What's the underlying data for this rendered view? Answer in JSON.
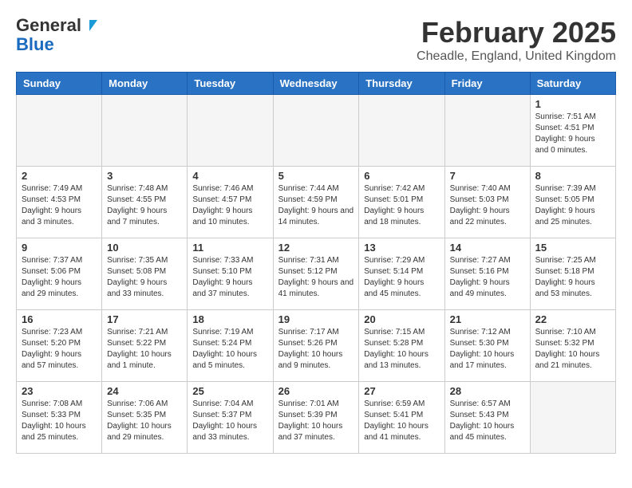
{
  "header": {
    "logo_general": "General",
    "logo_blue": "Blue",
    "title": "February 2025",
    "subtitle": "Cheadle, England, United Kingdom"
  },
  "weekdays": [
    "Sunday",
    "Monday",
    "Tuesday",
    "Wednesday",
    "Thursday",
    "Friday",
    "Saturday"
  ],
  "weeks": [
    [
      {
        "day": "",
        "info": ""
      },
      {
        "day": "",
        "info": ""
      },
      {
        "day": "",
        "info": ""
      },
      {
        "day": "",
        "info": ""
      },
      {
        "day": "",
        "info": ""
      },
      {
        "day": "",
        "info": ""
      },
      {
        "day": "1",
        "info": "Sunrise: 7:51 AM\nSunset: 4:51 PM\nDaylight: 9 hours and 0 minutes."
      }
    ],
    [
      {
        "day": "2",
        "info": "Sunrise: 7:49 AM\nSunset: 4:53 PM\nDaylight: 9 hours and 3 minutes."
      },
      {
        "day": "3",
        "info": "Sunrise: 7:48 AM\nSunset: 4:55 PM\nDaylight: 9 hours and 7 minutes."
      },
      {
        "day": "4",
        "info": "Sunrise: 7:46 AM\nSunset: 4:57 PM\nDaylight: 9 hours and 10 minutes."
      },
      {
        "day": "5",
        "info": "Sunrise: 7:44 AM\nSunset: 4:59 PM\nDaylight: 9 hours and 14 minutes."
      },
      {
        "day": "6",
        "info": "Sunrise: 7:42 AM\nSunset: 5:01 PM\nDaylight: 9 hours and 18 minutes."
      },
      {
        "day": "7",
        "info": "Sunrise: 7:40 AM\nSunset: 5:03 PM\nDaylight: 9 hours and 22 minutes."
      },
      {
        "day": "8",
        "info": "Sunrise: 7:39 AM\nSunset: 5:05 PM\nDaylight: 9 hours and 25 minutes."
      }
    ],
    [
      {
        "day": "9",
        "info": "Sunrise: 7:37 AM\nSunset: 5:06 PM\nDaylight: 9 hours and 29 minutes."
      },
      {
        "day": "10",
        "info": "Sunrise: 7:35 AM\nSunset: 5:08 PM\nDaylight: 9 hours and 33 minutes."
      },
      {
        "day": "11",
        "info": "Sunrise: 7:33 AM\nSunset: 5:10 PM\nDaylight: 9 hours and 37 minutes."
      },
      {
        "day": "12",
        "info": "Sunrise: 7:31 AM\nSunset: 5:12 PM\nDaylight: 9 hours and 41 minutes."
      },
      {
        "day": "13",
        "info": "Sunrise: 7:29 AM\nSunset: 5:14 PM\nDaylight: 9 hours and 45 minutes."
      },
      {
        "day": "14",
        "info": "Sunrise: 7:27 AM\nSunset: 5:16 PM\nDaylight: 9 hours and 49 minutes."
      },
      {
        "day": "15",
        "info": "Sunrise: 7:25 AM\nSunset: 5:18 PM\nDaylight: 9 hours and 53 minutes."
      }
    ],
    [
      {
        "day": "16",
        "info": "Sunrise: 7:23 AM\nSunset: 5:20 PM\nDaylight: 9 hours and 57 minutes."
      },
      {
        "day": "17",
        "info": "Sunrise: 7:21 AM\nSunset: 5:22 PM\nDaylight: 10 hours and 1 minute."
      },
      {
        "day": "18",
        "info": "Sunrise: 7:19 AM\nSunset: 5:24 PM\nDaylight: 10 hours and 5 minutes."
      },
      {
        "day": "19",
        "info": "Sunrise: 7:17 AM\nSunset: 5:26 PM\nDaylight: 10 hours and 9 minutes."
      },
      {
        "day": "20",
        "info": "Sunrise: 7:15 AM\nSunset: 5:28 PM\nDaylight: 10 hours and 13 minutes."
      },
      {
        "day": "21",
        "info": "Sunrise: 7:12 AM\nSunset: 5:30 PM\nDaylight: 10 hours and 17 minutes."
      },
      {
        "day": "22",
        "info": "Sunrise: 7:10 AM\nSunset: 5:32 PM\nDaylight: 10 hours and 21 minutes."
      }
    ],
    [
      {
        "day": "23",
        "info": "Sunrise: 7:08 AM\nSunset: 5:33 PM\nDaylight: 10 hours and 25 minutes."
      },
      {
        "day": "24",
        "info": "Sunrise: 7:06 AM\nSunset: 5:35 PM\nDaylight: 10 hours and 29 minutes."
      },
      {
        "day": "25",
        "info": "Sunrise: 7:04 AM\nSunset: 5:37 PM\nDaylight: 10 hours and 33 minutes."
      },
      {
        "day": "26",
        "info": "Sunrise: 7:01 AM\nSunset: 5:39 PM\nDaylight: 10 hours and 37 minutes."
      },
      {
        "day": "27",
        "info": "Sunrise: 6:59 AM\nSunset: 5:41 PM\nDaylight: 10 hours and 41 minutes."
      },
      {
        "day": "28",
        "info": "Sunrise: 6:57 AM\nSunset: 5:43 PM\nDaylight: 10 hours and 45 minutes."
      },
      {
        "day": "",
        "info": ""
      }
    ]
  ]
}
